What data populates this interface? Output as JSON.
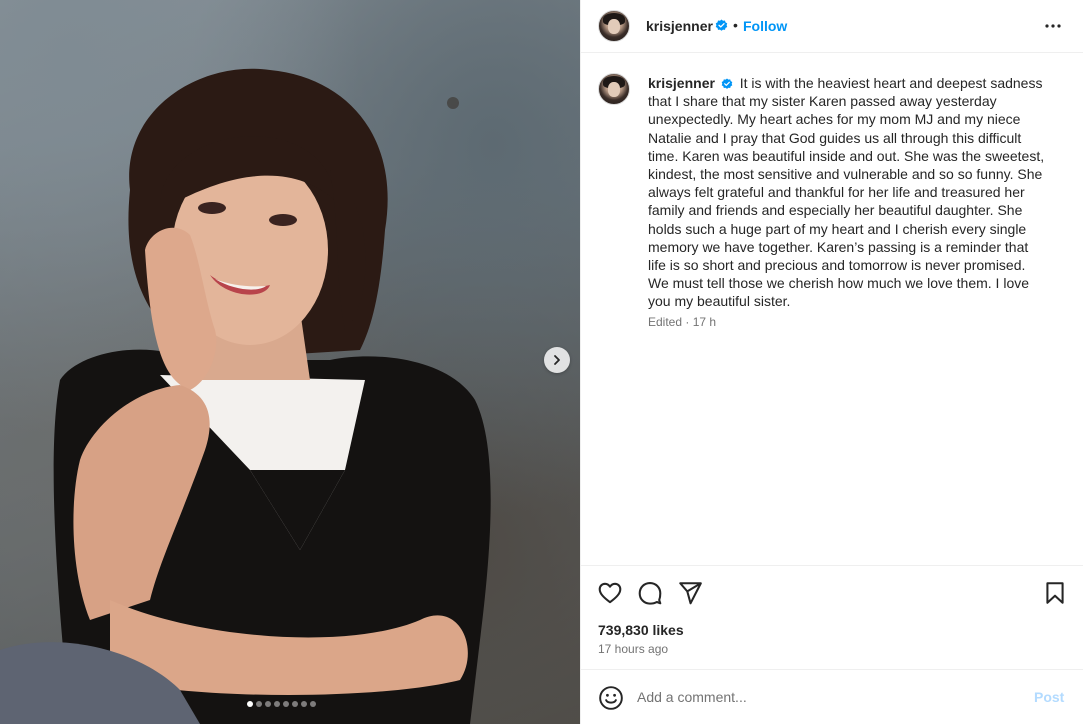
{
  "post": {
    "carousel": {
      "current": 1,
      "total": 8
    }
  },
  "header": {
    "username": "krisjenner",
    "separator": "•",
    "follow_label": "Follow",
    "verified_icon": "verified-badge-icon",
    "more_icon": "more-options-icon"
  },
  "caption": {
    "username": "krisjenner",
    "text": "It is with the heaviest heart and deepest sadness that I share that my sister Karen passed away yesterday unexpectedly. My heart aches for my mom MJ and my niece Natalie and I pray that God guides us all through this difficult time. Karen was beautiful inside and out. She was the sweetest, kindest, the most sensitive and vulnerable and so so funny. She always felt grateful and thankful for her life and treasured her family and friends and especially her beautiful daughter. She holds such a huge part of my heart and I cherish every single memory we have together. Karen’s passing is a reminder that life is so short and precious and tomorrow is never promised. We must tell those we cherish how much we love them. I love you my beautiful sister.",
    "meta": "Edited · 17 h"
  },
  "actions": {
    "icons": [
      "heart-icon",
      "comment-icon",
      "share-icon",
      "bookmark-icon"
    ],
    "likes": "739,830 likes",
    "time": "17 hours ago"
  },
  "comment_bar": {
    "placeholder": "Add a comment...",
    "post_label": "Post"
  },
  "colors": {
    "accent": "#0095f6",
    "post_disabled": "#b3dbff",
    "verified": "#0095f6",
    "muted_text": "#737373"
  }
}
